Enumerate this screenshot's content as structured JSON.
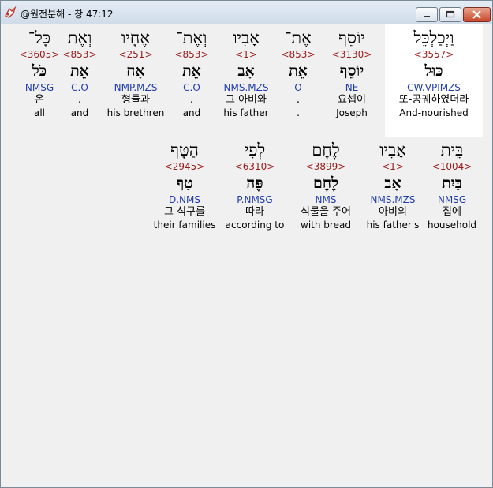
{
  "window": {
    "title": "@원전분해 - 창 47:12"
  },
  "row1": [
    {
      "heb": "כָּל־",
      "strong": "<3605>",
      "lemma": "כֹּל",
      "parse": "NMSG",
      "kor": "온",
      "eng": "all"
    },
    {
      "heb": "וְאֶת",
      "strong": "<853>",
      "lemma": "אֵת",
      "parse": "C.O",
      "kor": ".",
      "eng": "and"
    },
    {
      "heb": "אֶחָיו",
      "strong": "<251>",
      "lemma": "אָח",
      "parse": "NMP.MZS",
      "kor": "형들과",
      "eng": "his brethren"
    },
    {
      "heb": "וְאֶת־",
      "strong": "<853>",
      "lemma": "אֵת",
      "parse": "C.O",
      "kor": ".",
      "eng": "and"
    },
    {
      "heb": "אָבִיו",
      "strong": "<1>",
      "lemma": "אָב",
      "parse": "NMS.MZS",
      "kor": "그 아비와",
      "eng": "his father"
    },
    {
      "heb": "אֶת־",
      "strong": "<853>",
      "lemma": "אֵת",
      "parse": "O",
      "kor": ".",
      "eng": "."
    },
    {
      "heb": "יוֹסֵף",
      "strong": "<3130>",
      "lemma": "יוֹסֵף",
      "parse": "NE",
      "kor": "요셉이",
      "eng": "Joseph"
    },
    {
      "heb": "וַיְכַלְכֵּל",
      "strong": "<3557>",
      "lemma": "כּוּל",
      "parse": "CW.VPIMZS",
      "kor": "또-공궤하였더라",
      "eng": "And-nourished"
    }
  ],
  "row2": [
    {
      "heb": "הַטָּף",
      "strong": "<2945>",
      "lemma": "טַף",
      "parse": "D.NMS",
      "kor": "그 식구를",
      "eng": "their families"
    },
    {
      "heb": "לְפִי",
      "strong": "<6310>",
      "lemma": "פֶּה",
      "parse": "P.NMSG",
      "kor": "따라",
      "eng": "according to"
    },
    {
      "heb": "לֶחֶם",
      "strong": "<3899>",
      "lemma": "לֶחֶם",
      "parse": "NMS",
      "kor": "식물을 주어",
      "eng": "with bread"
    },
    {
      "heb": "אָבִיו",
      "strong": "<1>",
      "lemma": "אָב",
      "parse": "NMS.MZS",
      "kor": "아비의",
      "eng": "his father's"
    },
    {
      "heb": "בֵּית",
      "strong": "<1004>",
      "lemma": "בַּיִת",
      "parse": "NMSG",
      "kor": "집에",
      "eng": "household"
    }
  ]
}
